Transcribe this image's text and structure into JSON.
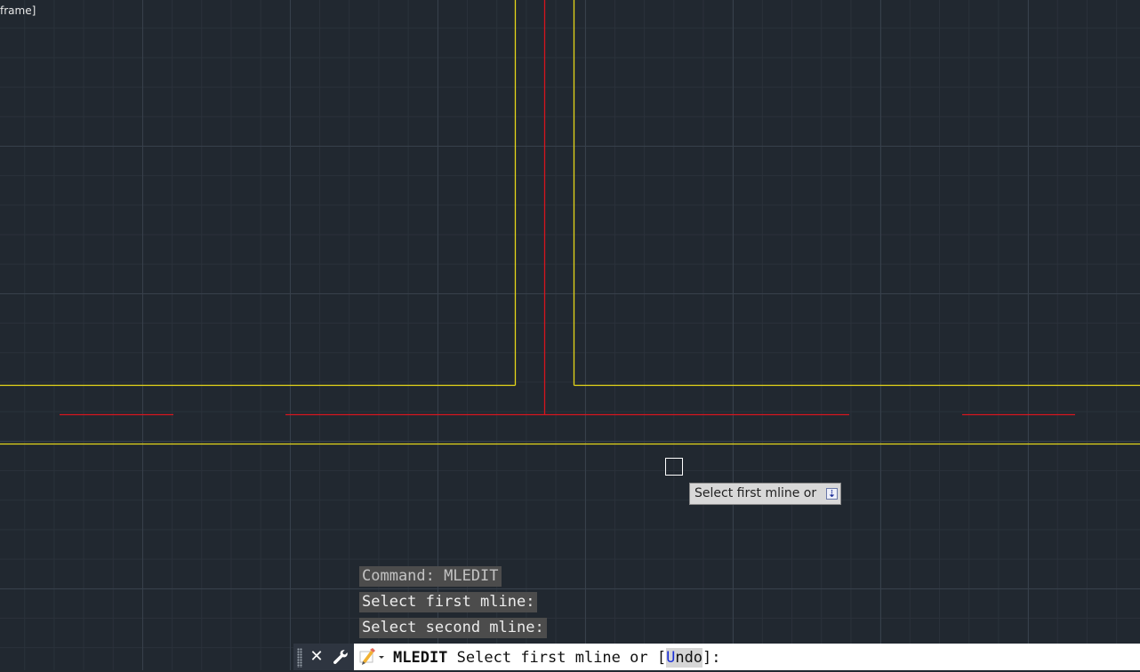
{
  "viewport": {
    "label": "frame]"
  },
  "drawing": {
    "yellow_color": "#e6d719",
    "red_color": "#d7151e"
  },
  "tooltip": {
    "text": "Select first mline or",
    "expand_icon": "arrow-down-box-icon"
  },
  "command_history": [
    "Command: MLEDIT",
    "Select first mline:",
    "Select second mline:"
  ],
  "command_line": {
    "command": "MLEDIT",
    "prompt_text": "Select first mline or [",
    "option_hotkey": "U",
    "option_rest": "ndo",
    "prompt_end": "]:",
    "icons": {
      "grip": "grip-handle-icon",
      "close": "close-icon",
      "customize": "wrench-icon",
      "recent": "recent-commands-icon"
    }
  },
  "colors": {
    "background": "#212830",
    "major_grid": "#37404b",
    "minor_grid": "#2a313a",
    "history_bg": "#4c4c4c",
    "option_hotkey": "#1a2fd8"
  }
}
